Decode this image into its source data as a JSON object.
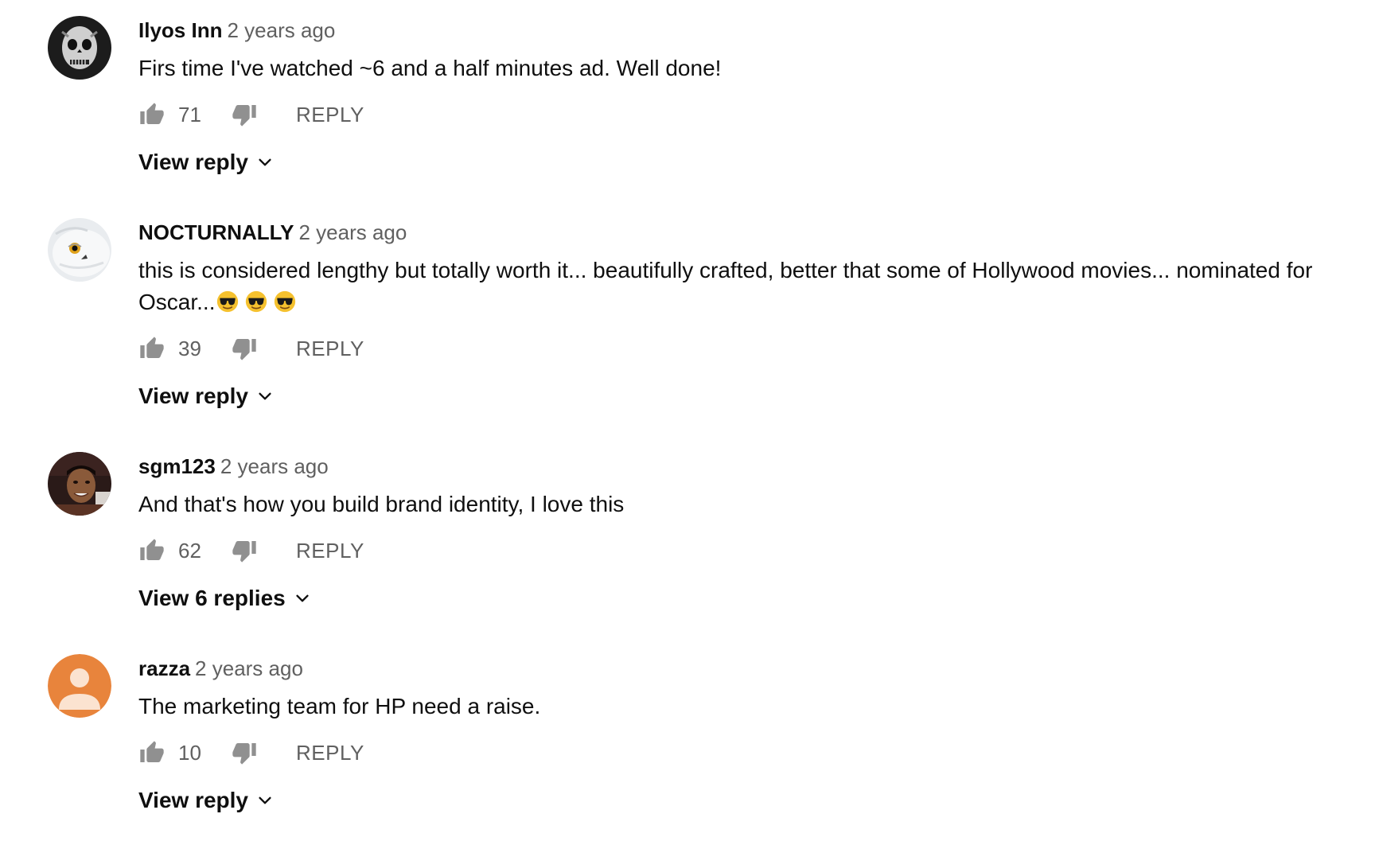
{
  "comments": [
    {
      "author": "Ilyos Inn",
      "time": "2 years ago",
      "text": "Firs time I've watched ~6 and a half minutes ad. Well done!",
      "likes": "71",
      "reply_label": "REPLY",
      "view_replies": "View reply",
      "avatar": "skull-mask-avatar"
    },
    {
      "author": "NOCTURNALLY",
      "time": "2 years ago",
      "text_line1": "this is considered lengthy but totally worth it... beautifully crafted, better that some of Hollywood movies...  nominated for",
      "text_line2": "Oscar...",
      "emoji": "smiling-face-with-sunglasses",
      "likes": "39",
      "reply_label": "REPLY",
      "view_replies": "View reply",
      "avatar": "owl-avatar"
    },
    {
      "author": "sgm123",
      "time": "2 years ago",
      "text": "And that's how you build brand identity, I love this",
      "likes": "62",
      "reply_label": "REPLY",
      "view_replies": "View 6 replies",
      "avatar": "person-photo-avatar"
    },
    {
      "author": "razza",
      "time": "2 years ago",
      "text": "The marketing team for HP need a raise.",
      "likes": "10",
      "reply_label": "REPLY",
      "view_replies": "View reply",
      "avatar": "default-person-avatar"
    }
  ],
  "colors": {
    "text": "#0f0f0f",
    "secondary": "#606060",
    "default_avatar": "#e8843c"
  }
}
